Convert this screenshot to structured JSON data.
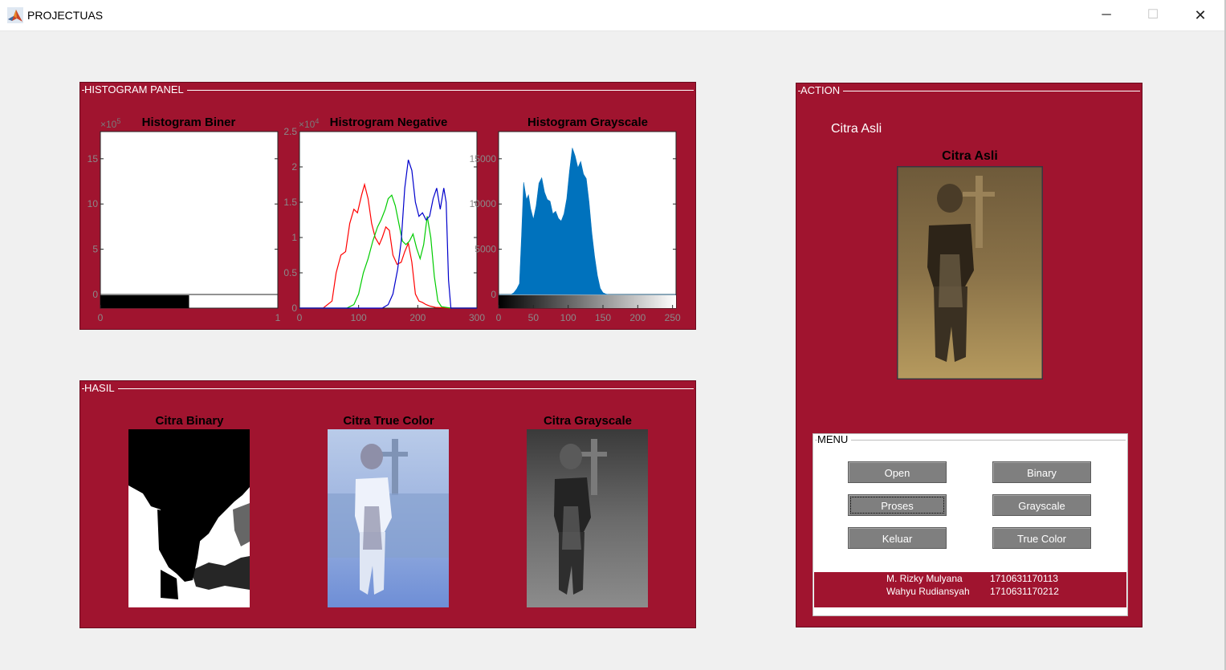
{
  "window": {
    "title": "PROJECTUAS",
    "minimize": "─",
    "maximize": "☐",
    "close": "✕",
    "icon": "matlab-icon"
  },
  "histogram_panel": {
    "title": "HISTOGRAM PANEL",
    "charts": [
      {
        "title": "Histogram Biner",
        "type": "bar",
        "exponent_label": "×10",
        "exponent": "5",
        "x_ticks": [
          "0",
          "1"
        ],
        "y_ticks": [
          "0",
          "5",
          "10",
          "15"
        ],
        "xlim": [
          0,
          1
        ],
        "ylim": [
          0,
          18
        ],
        "colorbar": "black-white",
        "chart_data": {
          "type": "bar",
          "note_values": "blank"
        }
      },
      {
        "title": "Histrogram Negative",
        "type": "line",
        "exponent_label": "×10",
        "exponent": "4",
        "x_ticks": [
          "0",
          "100",
          "200",
          "300"
        ],
        "y_ticks": [
          "0",
          "0.5",
          "1",
          "1.5",
          "2",
          "2.5"
        ],
        "xlim": [
          0,
          300
        ],
        "ylim": [
          0,
          2.5
        ]
      },
      {
        "title": "Histogram Grayscale",
        "type": "area",
        "x_ticks": [
          "0",
          "50",
          "100",
          "150",
          "200",
          "250"
        ],
        "y_ticks": [
          "0",
          "5000",
          "10000",
          "15000"
        ],
        "xlim": [
          0,
          255
        ],
        "ylim": [
          0,
          18000
        ],
        "colorbar": "black-white"
      }
    ]
  },
  "chart_data": [
    {
      "type": "bar",
      "title": "Histogram Biner",
      "x": [
        0,
        1
      ],
      "values": [
        0,
        0
      ],
      "xlim": [
        0,
        1
      ],
      "ylim": [
        0,
        18
      ],
      "y_scale": "×10^5"
    },
    {
      "type": "line",
      "title": "Histrogram Negative",
      "xlim": [
        0,
        300
      ],
      "ylim": [
        0,
        2.5
      ],
      "y_scale": "×10^4",
      "series": [
        {
          "color": "#ff0000",
          "x": [
            0,
            40,
            55,
            62,
            70,
            78,
            85,
            92,
            98,
            105,
            110,
            116,
            122,
            128,
            135,
            140,
            146,
            152,
            158,
            165,
            172,
            178,
            184,
            190,
            196,
            202,
            208,
            214,
            220,
            230,
            256,
            300
          ],
          "y": [
            0,
            0,
            0.1,
            0.5,
            0.75,
            0.8,
            1.2,
            1.4,
            1.35,
            1.6,
            1.75,
            1.55,
            1.2,
            1.0,
            0.9,
            1.0,
            1.15,
            1.1,
            0.75,
            0.62,
            0.65,
            0.8,
            0.92,
            0.65,
            0.2,
            0.1,
            0.08,
            0.05,
            0.03,
            0.01,
            0,
            0
          ]
        },
        {
          "color": "#00cc00",
          "x": [
            0,
            80,
            92,
            100,
            108,
            116,
            124,
            132,
            138,
            145,
            150,
            156,
            162,
            168,
            174,
            180,
            186,
            192,
            198,
            204,
            210,
            216,
            222,
            228,
            234,
            240,
            256,
            300
          ],
          "y": [
            0,
            0,
            0.05,
            0.2,
            0.5,
            0.7,
            0.95,
            1.15,
            1.25,
            1.4,
            1.55,
            1.6,
            1.45,
            1.2,
            0.95,
            0.9,
            0.95,
            1.05,
            0.85,
            0.7,
            0.9,
            1.3,
            1.0,
            0.45,
            0.1,
            0.02,
            0,
            0
          ]
        },
        {
          "color": "#0000cc",
          "x": [
            0,
            140,
            150,
            158,
            166,
            172,
            178,
            184,
            190,
            196,
            202,
            208,
            214,
            220,
            226,
            232,
            238,
            244,
            248,
            252,
            256,
            300
          ],
          "y": [
            0,
            0,
            0.05,
            0.2,
            0.55,
            0.95,
            1.7,
            2.1,
            1.95,
            1.5,
            1.3,
            1.35,
            1.25,
            1.3,
            1.55,
            1.7,
            1.4,
            1.7,
            1.5,
            0.4,
            0,
            0
          ]
        }
      ]
    },
    {
      "type": "area",
      "title": "Histogram Grayscale",
      "xlim": [
        0,
        255
      ],
      "ylim": [
        0,
        18000
      ],
      "color": "#0072bd",
      "x": [
        0,
        18,
        22,
        26,
        30,
        33,
        36,
        40,
        43,
        46,
        50,
        54,
        58,
        62,
        66,
        70,
        74,
        78,
        82,
        86,
        90,
        94,
        98,
        102,
        106,
        110,
        114,
        118,
        122,
        126,
        130,
        134,
        138,
        142,
        146,
        150,
        154,
        158,
        160,
        300
      ],
      "y": [
        0,
        0,
        200,
        600,
        1200,
        6500,
        12400,
        10500,
        11000,
        9500,
        8300,
        9800,
        12300,
        12900,
        11300,
        10500,
        10300,
        8900,
        9200,
        8400,
        8100,
        8900,
        10600,
        13700,
        16200,
        15300,
        14000,
        14700,
        13300,
        12800,
        10200,
        6800,
        4200,
        2100,
        700,
        200,
        50,
        0,
        0,
        0
      ]
    }
  ],
  "hasil_panel": {
    "title": "HASIL",
    "images": [
      {
        "title": "Citra Binary",
        "kind": "binary"
      },
      {
        "title": "Citra True Color",
        "kind": "truecolor"
      },
      {
        "title": "Citra Grayscale",
        "kind": "grayscale"
      }
    ]
  },
  "action_panel": {
    "title": "ACTION",
    "label": "Citra Asli",
    "image_title": "Citra Asli",
    "menu": {
      "title": "MENU",
      "buttons": {
        "open": "Open",
        "binary": "Binary",
        "proses": "Proses",
        "grayscale": "Grayscale",
        "keluar": "Keluar",
        "truecolor": "True Color"
      }
    },
    "credits": [
      {
        "name": "M. Rizky Mulyana",
        "nim": "1710631170113"
      },
      {
        "name": "Wahyu Rudiansyah",
        "nim": "1710631170212"
      }
    ]
  },
  "colors": {
    "panel": "#a0142f",
    "button": "#7f7f7f",
    "hist_fill": "#0072bd"
  }
}
